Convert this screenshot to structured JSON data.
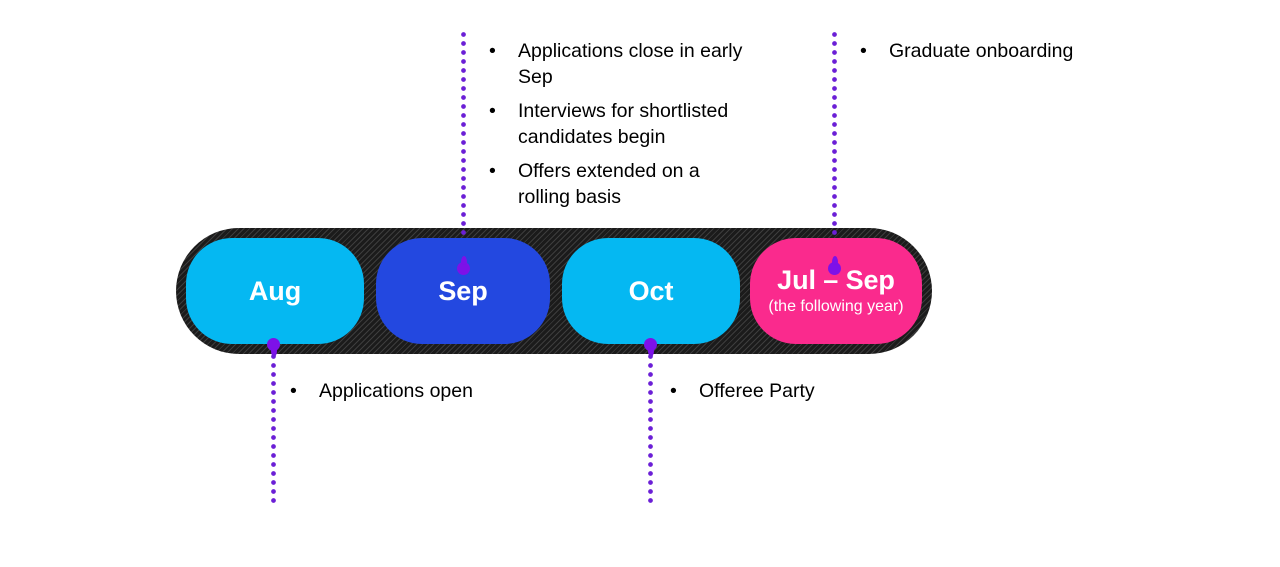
{
  "diagram": {
    "type": "recruitment-timeline",
    "colors": {
      "cyan": "#05b8f2",
      "blue": "#2348e0",
      "pink": "#fa2a8d",
      "track_dark": "#1c1c1c",
      "track_hatch": "#3d3d3d",
      "connector_purple": "#7d11e8",
      "text_dark": "#000000",
      "pill_text": "#ffffff"
    }
  },
  "timeline": {
    "stages": [
      {
        "label": "Aug",
        "sub": "",
        "color": "#05b8f2"
      },
      {
        "label": "Sep",
        "sub": "",
        "color": "#2348e0"
      },
      {
        "label": "Oct",
        "sub": "",
        "color": "#05b8f2"
      },
      {
        "label": "Jul – Sep",
        "sub": "(the following year)",
        "color": "#fa2a8d"
      }
    ]
  },
  "callouts": {
    "sep": {
      "bullet": "•",
      "items": [
        "Applications close in early Sep",
        "Interviews for shortlisted candidates begin",
        "Offers extended on a rolling basis"
      ]
    },
    "julsep": {
      "bullet": "•",
      "items": [
        "Graduate onboarding"
      ]
    },
    "aug": {
      "bullet": "•",
      "items": [
        "Applications open"
      ]
    },
    "oct": {
      "bullet": "•",
      "items": [
        "Offeree Party"
      ]
    }
  }
}
